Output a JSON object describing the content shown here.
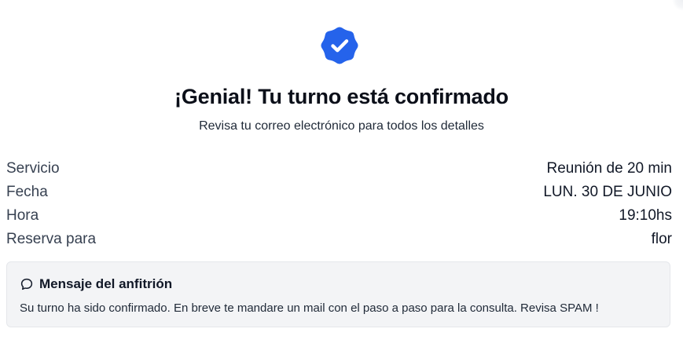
{
  "colors": {
    "accent": "#2563eb",
    "text": "#111827",
    "muted": "#374151",
    "message_bg": "#f3f4f6"
  },
  "confirmation": {
    "icon": "verified-badge-check-icon",
    "title": "¡Genial! Tu turno está confirmado",
    "subtitle": "Revisa tu correo electrónico para todos los detalles"
  },
  "details": {
    "rows": [
      {
        "label": "Servicio",
        "value": "Reunión de 20 min"
      },
      {
        "label": "Fecha",
        "value": "LUN. 30 DE JUNIO"
      },
      {
        "label": "Hora",
        "value": "19:10hs"
      },
      {
        "label": "Reserva para",
        "value": "flor"
      }
    ]
  },
  "host_message": {
    "icon": "chat-bubble-icon",
    "title": "Mensaje del anfitrión",
    "text": "Su turno ha sido confirmado. En breve te mandare un mail con el paso a paso para la consulta. Revisa SPAM !"
  }
}
